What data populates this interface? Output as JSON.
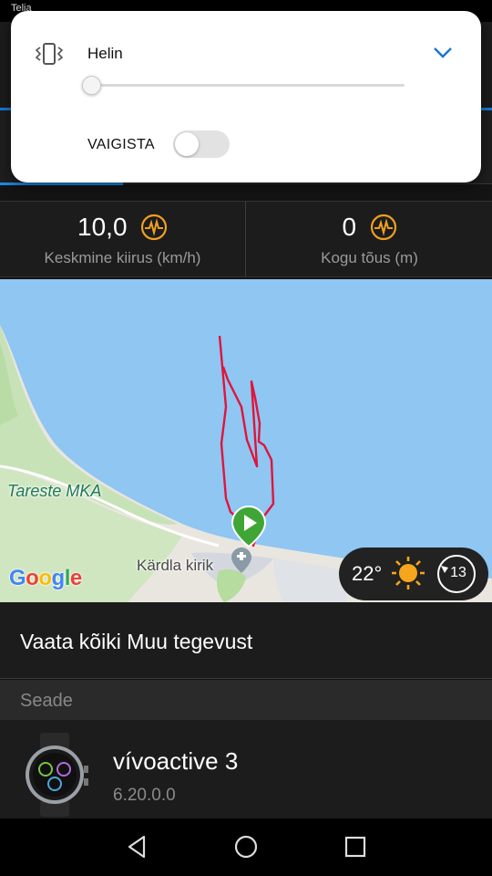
{
  "status_bar": {
    "carrier": "Telia"
  },
  "volume_panel": {
    "title": "Helin",
    "mute_label": "VAIGISTA",
    "volume_level": 0,
    "mute_on": false,
    "icons": [
      "vibrate-icon",
      "chevron-down-icon"
    ],
    "accent_color": "#1976d2"
  },
  "stats": [
    {
      "value": "10,0",
      "label": "Keskmine kiirus (km/h)",
      "icon": "pulse-chart-icon"
    },
    {
      "value": "0",
      "label": "Kogu tõus (m)",
      "icon": "pulse-chart-icon"
    }
  ],
  "map": {
    "labels": {
      "tareste": "Tareste MKA",
      "kirik": "Kärdla kirik"
    },
    "google_logo": "Google",
    "route_color": "#e0143c",
    "weather": {
      "temperature": "22°",
      "icon": "sun-icon",
      "uv_index": "13"
    }
  },
  "list": {
    "see_all": "Vaata kõiki Muu tegevust",
    "section_header": "Seade",
    "device": {
      "name": "vívoactive 3",
      "firmware": "6.20.0.0"
    }
  },
  "navbar": {
    "icons": [
      "back-icon",
      "home-icon",
      "recents-icon"
    ]
  }
}
